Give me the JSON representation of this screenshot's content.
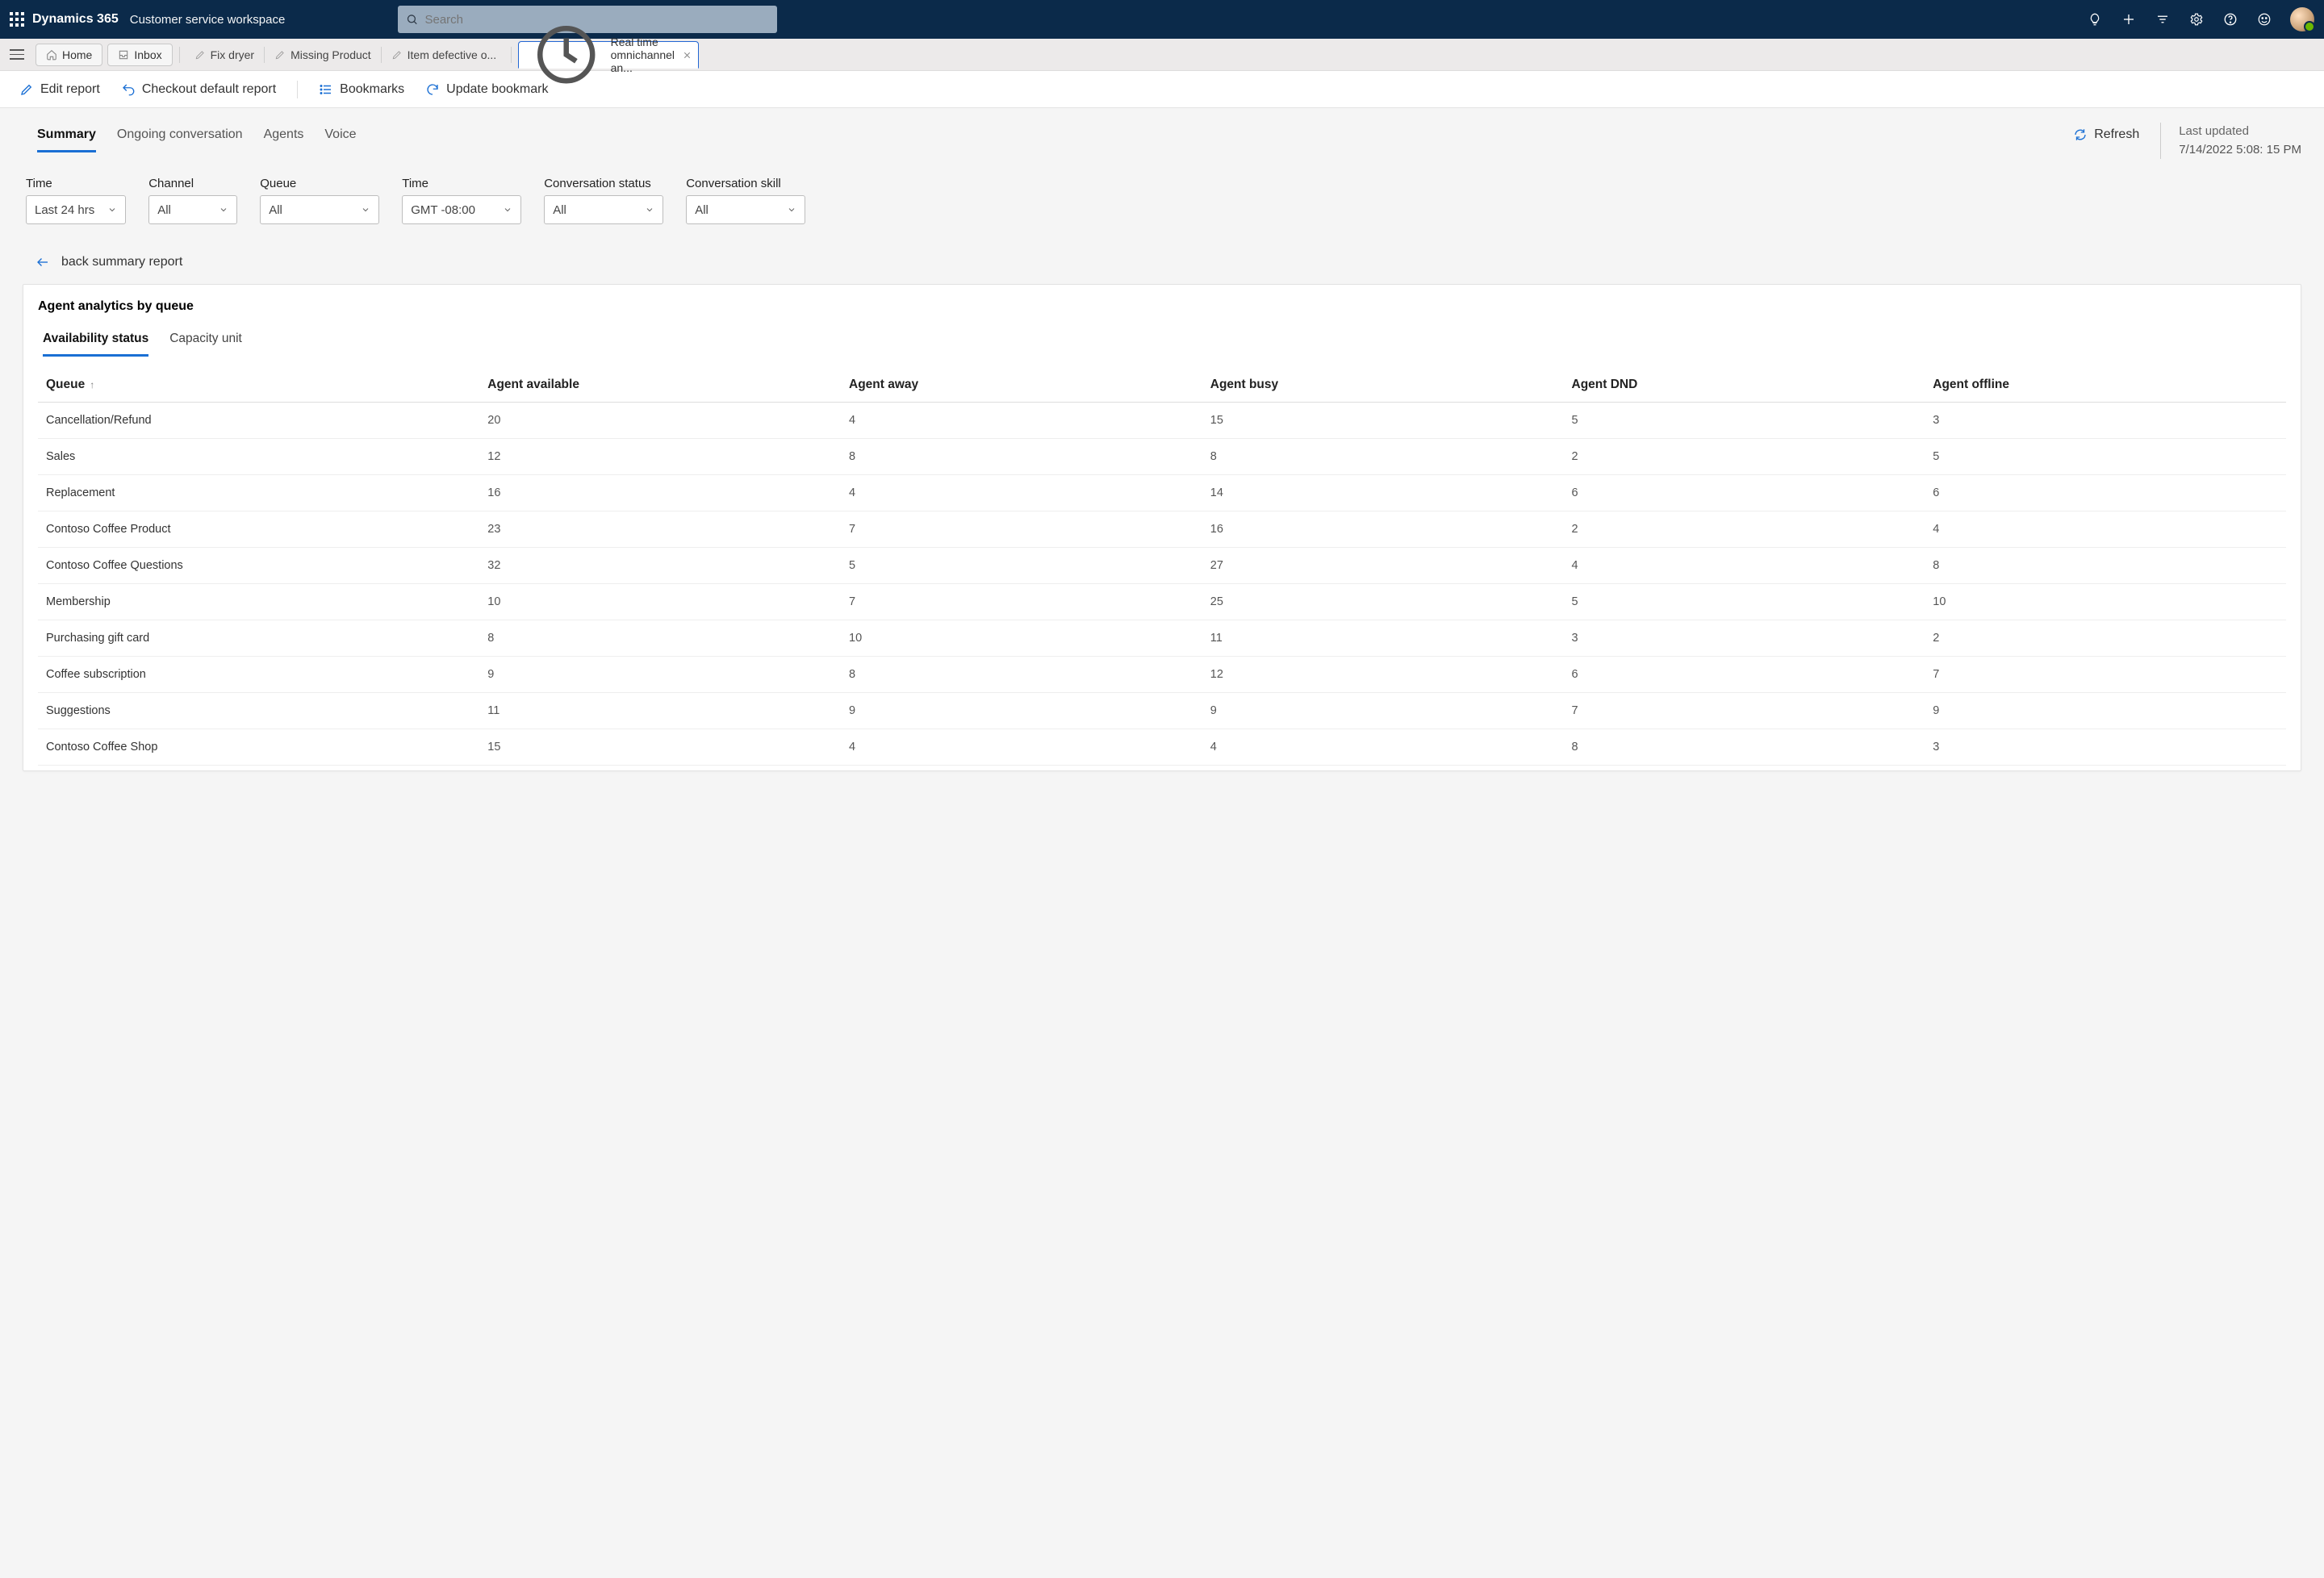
{
  "header": {
    "brand": "Dynamics 365",
    "subbrand": "Customer service workspace",
    "search_placeholder": "Search"
  },
  "tabs": {
    "home": "Home",
    "inbox": "Inbox",
    "items": [
      "Fix dryer",
      "Missing Product",
      "Item defective o..."
    ],
    "active": "Real time omnichannel an..."
  },
  "toolbar": {
    "edit": "Edit report",
    "checkout": "Checkout default report",
    "bookmarks": "Bookmarks",
    "update": "Update bookmark"
  },
  "viewtabs": [
    "Summary",
    "Ongoing conversation",
    "Agents",
    "Voice"
  ],
  "refresh": "Refresh",
  "last_updated_label": "Last updated",
  "last_updated_value": "7/14/2022 5:08: 15 PM",
  "filters": [
    {
      "label": "Time",
      "value": "Last 24 hrs",
      "w": "w110"
    },
    {
      "label": "Channel",
      "value": "All",
      "w": "w110"
    },
    {
      "label": "Queue",
      "value": "All",
      "w": "w150"
    },
    {
      "label": "Time",
      "value": "GMT -08:00",
      "w": "w150"
    },
    {
      "label": "Conversation status",
      "value": "All",
      "w": "w150"
    },
    {
      "label": "Conversation skill",
      "value": "All",
      "w": "w150"
    }
  ],
  "back_link": "back summary report",
  "card": {
    "title": "Agent analytics by queue",
    "subtabs": [
      "Availability status",
      "Capacity unit"
    ],
    "columns": [
      "Queue",
      "Agent available",
      "Agent away",
      "Agent busy",
      "Agent DND",
      "Agent offline"
    ],
    "rows": [
      {
        "queue": "Cancellation/Refund",
        "available": "20",
        "away": "4",
        "busy": "15",
        "dnd": "5",
        "offline": "3"
      },
      {
        "queue": "Sales",
        "available": "12",
        "away": "8",
        "busy": "8",
        "dnd": "2",
        "offline": "5"
      },
      {
        "queue": "Replacement",
        "available": "16",
        "away": "4",
        "busy": "14",
        "dnd": "6",
        "offline": "6"
      },
      {
        "queue": "Contoso Coffee Product",
        "available": "23",
        "away": "7",
        "busy": "16",
        "dnd": "2",
        "offline": "4"
      },
      {
        "queue": "Contoso Coffee Questions",
        "available": "32",
        "away": "5",
        "busy": "27",
        "dnd": "4",
        "offline": "8"
      },
      {
        "queue": "Membership",
        "available": "10",
        "away": "7",
        "busy": "25",
        "dnd": "5",
        "offline": "10"
      },
      {
        "queue": "Purchasing gift card",
        "available": "8",
        "away": "10",
        "busy": "11",
        "dnd": "3",
        "offline": "2"
      },
      {
        "queue": "Coffee subscription",
        "available": "9",
        "away": "8",
        "busy": "12",
        "dnd": "6",
        "offline": "7"
      },
      {
        "queue": "Suggestions",
        "available": "11",
        "away": "9",
        "busy": "9",
        "dnd": "7",
        "offline": "9"
      },
      {
        "queue": "Contoso Coffee Shop",
        "available": "15",
        "away": "4",
        "busy": "4",
        "dnd": "8",
        "offline": "3"
      }
    ]
  }
}
